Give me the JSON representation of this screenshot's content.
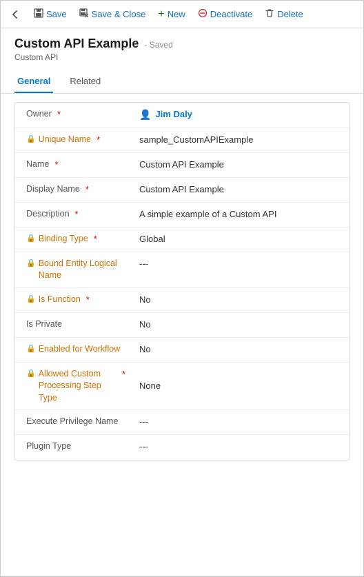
{
  "toolbar": {
    "back_label": "←",
    "save_label": "Save",
    "save_close_label": "Save & Close",
    "new_label": "New",
    "deactivate_label": "Deactivate",
    "delete_label": "Delete"
  },
  "header": {
    "title": "Custom API Example",
    "saved_badge": "- Saved",
    "subtitle": "Custom API"
  },
  "tabs": [
    {
      "id": "general",
      "label": "General",
      "active": true
    },
    {
      "id": "related",
      "label": "Related",
      "active": false
    }
  ],
  "fields": [
    {
      "label": "Owner",
      "locked": false,
      "required": true,
      "value": "Jim Daly",
      "value_type": "user_link",
      "empty": false
    },
    {
      "label": "Unique Name",
      "locked": true,
      "required": true,
      "value": "sample_CustomAPIExample",
      "value_type": "text",
      "empty": false
    },
    {
      "label": "Name",
      "locked": false,
      "required": true,
      "value": "Custom API Example",
      "value_type": "text",
      "empty": false
    },
    {
      "label": "Display Name",
      "locked": false,
      "required": true,
      "value": "Custom API Example",
      "value_type": "text",
      "empty": false
    },
    {
      "label": "Description",
      "locked": false,
      "required": true,
      "value": "A simple example of a Custom API",
      "value_type": "text",
      "empty": false
    },
    {
      "label": "Binding Type",
      "locked": true,
      "required": true,
      "value": "Global",
      "value_type": "text",
      "empty": false
    },
    {
      "label": "Bound Entity Logical Name",
      "locked": true,
      "required": false,
      "value": "---",
      "value_type": "text",
      "empty": true
    },
    {
      "label": "Is Function",
      "locked": true,
      "required": true,
      "value": "No",
      "value_type": "text",
      "empty": false
    },
    {
      "label": "Is Private",
      "locked": false,
      "required": false,
      "value": "No",
      "value_type": "text",
      "empty": false
    },
    {
      "label": "Enabled for Workflow",
      "locked": true,
      "required": false,
      "value": "No",
      "value_type": "text",
      "empty": false
    },
    {
      "label": "Allowed Custom Processing Step Type",
      "locked": true,
      "required": true,
      "value": "None",
      "value_type": "text",
      "empty": false
    },
    {
      "label": "Execute Privilege Name",
      "locked": false,
      "required": false,
      "value": "---",
      "value_type": "text",
      "empty": true
    },
    {
      "label": "Plugin Type",
      "locked": false,
      "required": false,
      "value": "---",
      "value_type": "text",
      "empty": true
    }
  ]
}
